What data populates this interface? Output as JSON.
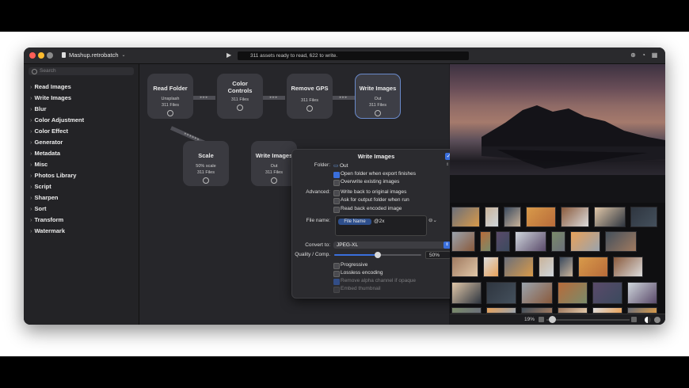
{
  "window": {
    "title": "Mashup.retrobatch",
    "status": "311 assets ready to read, 622 to write.",
    "traffic_colors": [
      "#ff5f57",
      "#febc2e",
      "#8b8b8b"
    ]
  },
  "sidebar": {
    "search_placeholder": "Search",
    "items": [
      {
        "label": "Read Images"
      },
      {
        "label": "Write Images"
      },
      {
        "label": "Blur"
      },
      {
        "label": "Color Adjustment"
      },
      {
        "label": "Color Effect"
      },
      {
        "label": "Generator"
      },
      {
        "label": "Metadata"
      },
      {
        "label": "Misc"
      },
      {
        "label": "Photos Library"
      },
      {
        "label": "Script"
      },
      {
        "label": "Sharpen"
      },
      {
        "label": "Sort"
      },
      {
        "label": "Transform"
      },
      {
        "label": "Watermark"
      }
    ]
  },
  "nodes": [
    {
      "title": "Read Folder",
      "sub": "Unsplash",
      "files": "311 Files"
    },
    {
      "title": "Color Controls",
      "sub": "",
      "files": "311 Files"
    },
    {
      "title": "Remove GPS",
      "sub": "",
      "files": "311 Files"
    },
    {
      "title": "Write Images",
      "sub": "Out",
      "files": "311 Files"
    },
    {
      "title": "Scale",
      "sub": "50% scale",
      "files": "311 Files"
    },
    {
      "title": "Write Images",
      "sub": "Out",
      "files": "311 Files"
    }
  ],
  "panel": {
    "title": "Write Images",
    "folder_label": "Folder:",
    "folder_value": "Out",
    "open_folder": "Open folder when export finishes",
    "overwrite": "Overwrite existing images",
    "advanced_label": "Advanced:",
    "write_back": "Write back to original images",
    "ask_output": "Ask for output folder when run",
    "read_back": "Read back encoded image",
    "file_name_label": "File name:",
    "file_name_token": "File Name",
    "file_name_suffix": "@2x",
    "convert_label": "Convert to:",
    "convert_value": "JPEG-XL",
    "quality_label": "Quality / Comp.",
    "quality_value": "50%",
    "quality_fraction": 0.5,
    "progressive": "Progressive",
    "lossless": "Lossless encoding",
    "remove_alpha": "Remove alpha channel if opaque",
    "embed_thumb": "Embed thumbnail"
  },
  "preview": {
    "zoom": "19%"
  },
  "colors": {
    "accent": "#3a6fdc"
  }
}
